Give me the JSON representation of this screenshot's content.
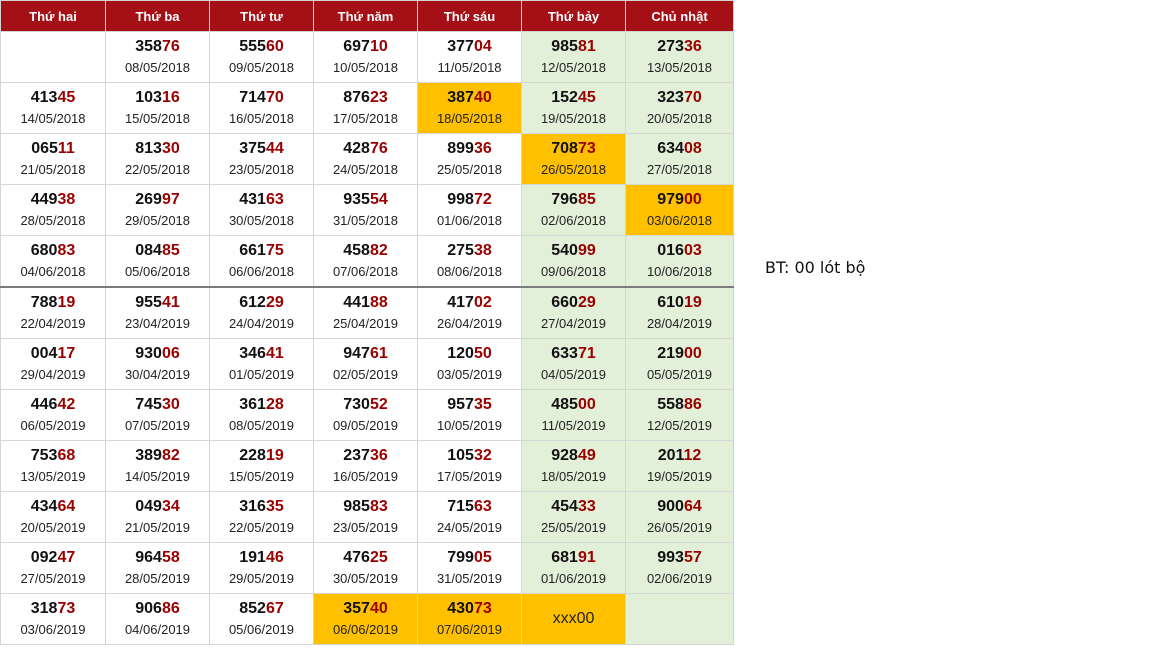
{
  "headers": [
    "Thứ hai",
    "Thứ ba",
    "Thứ tư",
    "Thứ năm",
    "Thứ sáu",
    "Thứ bảy",
    "Chủ nhật"
  ],
  "note": "BT: 00 lót bộ",
  "rows": [
    [
      {
        "head": "",
        "tail": "",
        "date": ""
      },
      {
        "head": "358",
        "tail": "76",
        "date": "08/05/2018"
      },
      {
        "head": "555",
        "tail": "60",
        "date": "09/05/2018"
      },
      {
        "head": "697",
        "tail": "10",
        "date": "10/05/2018"
      },
      {
        "head": "377",
        "tail": "04",
        "date": "11/05/2018"
      },
      {
        "head": "985",
        "tail": "81",
        "date": "12/05/2018"
      },
      {
        "head": "273",
        "tail": "36",
        "date": "13/05/2018"
      }
    ],
    [
      {
        "head": "413",
        "tail": "45",
        "date": "14/05/2018"
      },
      {
        "head": "103",
        "tail": "16",
        "date": "15/05/2018"
      },
      {
        "head": "714",
        "tail": "70",
        "date": "16/05/2018"
      },
      {
        "head": "876",
        "tail": "23",
        "date": "17/05/2018"
      },
      {
        "head": "387",
        "tail": "40",
        "date": "18/05/2018",
        "hl": true
      },
      {
        "head": "152",
        "tail": "45",
        "date": "19/05/2018"
      },
      {
        "head": "323",
        "tail": "70",
        "date": "20/05/2018"
      }
    ],
    [
      {
        "head": "065",
        "tail": "11",
        "date": "21/05/2018"
      },
      {
        "head": "813",
        "tail": "30",
        "date": "22/05/2018"
      },
      {
        "head": "375",
        "tail": "44",
        "date": "23/05/2018"
      },
      {
        "head": "428",
        "tail": "76",
        "date": "24/05/2018"
      },
      {
        "head": "899",
        "tail": "36",
        "date": "25/05/2018"
      },
      {
        "head": "708",
        "tail": "73",
        "date": "26/05/2018",
        "hl": true
      },
      {
        "head": "634",
        "tail": "08",
        "date": "27/05/2018"
      }
    ],
    [
      {
        "head": "449",
        "tail": "38",
        "date": "28/05/2018"
      },
      {
        "head": "269",
        "tail": "97",
        "date": "29/05/2018"
      },
      {
        "head": "431",
        "tail": "63",
        "date": "30/05/2018"
      },
      {
        "head": "935",
        "tail": "54",
        "date": "31/05/2018"
      },
      {
        "head": "998",
        "tail": "72",
        "date": "01/06/2018"
      },
      {
        "head": "796",
        "tail": "85",
        "date": "02/06/2018"
      },
      {
        "head": "979",
        "tail": "00",
        "date": "03/06/2018",
        "hl": true
      }
    ],
    [
      {
        "head": "680",
        "tail": "83",
        "date": "04/06/2018"
      },
      {
        "head": "084",
        "tail": "85",
        "date": "05/06/2018"
      },
      {
        "head": "661",
        "tail": "75",
        "date": "06/06/2018"
      },
      {
        "head": "458",
        "tail": "82",
        "date": "07/06/2018"
      },
      {
        "head": "275",
        "tail": "38",
        "date": "08/06/2018"
      },
      {
        "head": "540",
        "tail": "99",
        "date": "09/06/2018"
      },
      {
        "head": "016",
        "tail": "03",
        "date": "10/06/2018"
      }
    ],
    [
      {
        "head": "788",
        "tail": "19",
        "date": "22/04/2019"
      },
      {
        "head": "955",
        "tail": "41",
        "date": "23/04/2019"
      },
      {
        "head": "612",
        "tail": "29",
        "date": "24/04/2019"
      },
      {
        "head": "441",
        "tail": "88",
        "date": "25/04/2019"
      },
      {
        "head": "417",
        "tail": "02",
        "date": "26/04/2019"
      },
      {
        "head": "660",
        "tail": "29",
        "date": "27/04/2019"
      },
      {
        "head": "610",
        "tail": "19",
        "date": "28/04/2019"
      }
    ],
    [
      {
        "head": "004",
        "tail": "17",
        "date": "29/04/2019"
      },
      {
        "head": "930",
        "tail": "06",
        "date": "30/04/2019"
      },
      {
        "head": "346",
        "tail": "41",
        "date": "01/05/2019"
      },
      {
        "head": "947",
        "tail": "61",
        "date": "02/05/2019"
      },
      {
        "head": "120",
        "tail": "50",
        "date": "03/05/2019"
      },
      {
        "head": "633",
        "tail": "71",
        "date": "04/05/2019"
      },
      {
        "head": "219",
        "tail": "00",
        "date": "05/05/2019"
      }
    ],
    [
      {
        "head": "446",
        "tail": "42",
        "date": "06/05/2019"
      },
      {
        "head": "745",
        "tail": "30",
        "date": "07/05/2019"
      },
      {
        "head": "361",
        "tail": "28",
        "date": "08/05/2019"
      },
      {
        "head": "730",
        "tail": "52",
        "date": "09/05/2019"
      },
      {
        "head": "957",
        "tail": "35",
        "date": "10/05/2019"
      },
      {
        "head": "485",
        "tail": "00",
        "date": "11/05/2019"
      },
      {
        "head": "558",
        "tail": "86",
        "date": "12/05/2019"
      }
    ],
    [
      {
        "head": "753",
        "tail": "68",
        "date": "13/05/2019"
      },
      {
        "head": "389",
        "tail": "82",
        "date": "14/05/2019"
      },
      {
        "head": "228",
        "tail": "19",
        "date": "15/05/2019"
      },
      {
        "head": "237",
        "tail": "36",
        "date": "16/05/2019"
      },
      {
        "head": "105",
        "tail": "32",
        "date": "17/05/2019"
      },
      {
        "head": "928",
        "tail": "49",
        "date": "18/05/2019"
      },
      {
        "head": "201",
        "tail": "12",
        "date": "19/05/2019"
      }
    ],
    [
      {
        "head": "434",
        "tail": "64",
        "date": "20/05/2019"
      },
      {
        "head": "049",
        "tail": "34",
        "date": "21/05/2019"
      },
      {
        "head": "316",
        "tail": "35",
        "date": "22/05/2019"
      },
      {
        "head": "985",
        "tail": "83",
        "date": "23/05/2019"
      },
      {
        "head": "715",
        "tail": "63",
        "date": "24/05/2019"
      },
      {
        "head": "454",
        "tail": "33",
        "date": "25/05/2019"
      },
      {
        "head": "900",
        "tail": "64",
        "date": "26/05/2019"
      }
    ],
    [
      {
        "head": "092",
        "tail": "47",
        "date": "27/05/2019"
      },
      {
        "head": "964",
        "tail": "58",
        "date": "28/05/2019"
      },
      {
        "head": "191",
        "tail": "46",
        "date": "29/05/2019"
      },
      {
        "head": "476",
        "tail": "25",
        "date": "30/05/2019"
      },
      {
        "head": "799",
        "tail": "05",
        "date": "31/05/2019"
      },
      {
        "head": "681",
        "tail": "91",
        "date": "01/06/2019"
      },
      {
        "head": "993",
        "tail": "57",
        "date": "02/06/2019"
      }
    ],
    [
      {
        "head": "318",
        "tail": "73",
        "date": "03/06/2019"
      },
      {
        "head": "906",
        "tail": "86",
        "date": "04/06/2019"
      },
      {
        "head": "852",
        "tail": "67",
        "date": "05/06/2019"
      },
      {
        "head": "357",
        "tail": "40",
        "date": "06/06/2019",
        "hl": true
      },
      {
        "head": "430",
        "tail": "73",
        "date": "07/06/2019",
        "hl": true
      },
      {
        "text": "xxx00",
        "hl": true
      },
      {
        "head": "",
        "tail": "",
        "date": ""
      }
    ]
  ]
}
